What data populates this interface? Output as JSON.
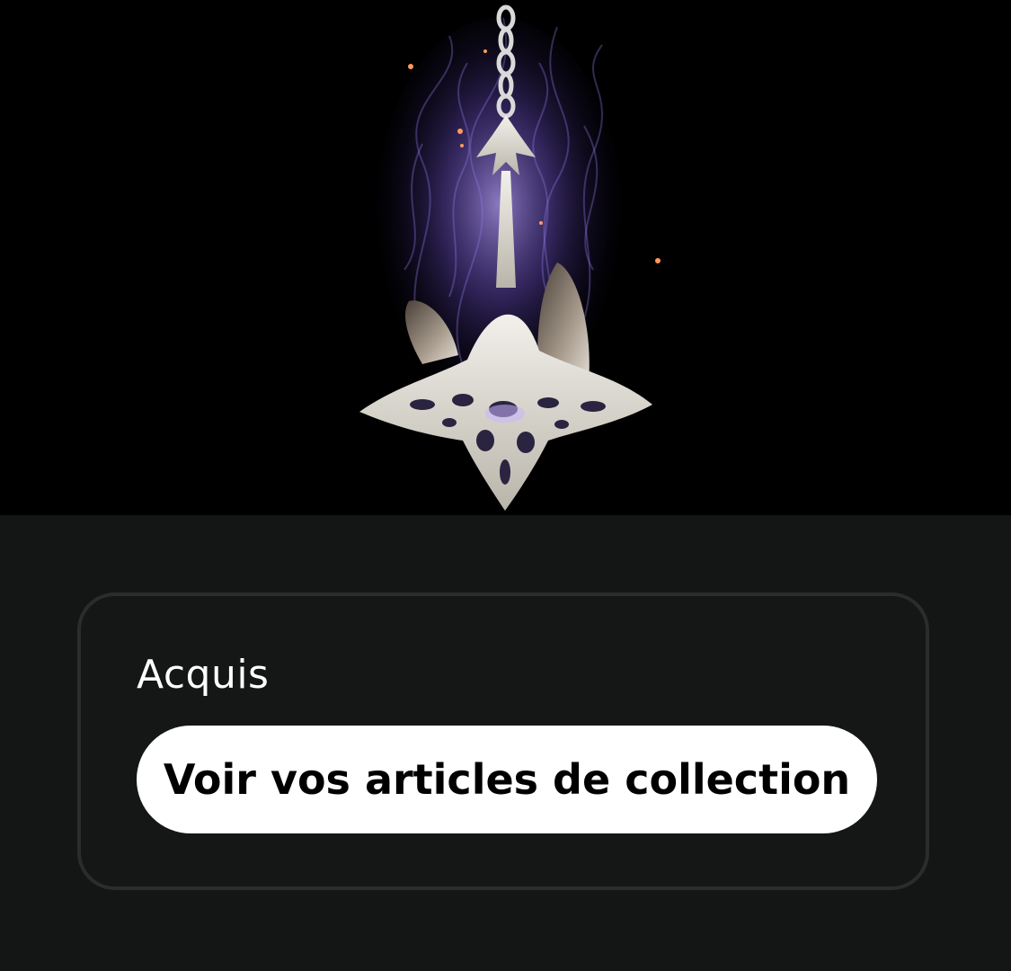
{
  "hero": {
    "image_name": "collectible-artwork"
  },
  "acquired_card": {
    "status": "Acquis",
    "button_label": "Voir vos articles de collection"
  },
  "colors": {
    "page_background": "#141515",
    "hero_background": "#000000",
    "card_border": "#2b2c2c",
    "button_background": "#ffffff",
    "button_text": "#000000",
    "status_text": "#ffffff",
    "glow": "#8a6cd8",
    "sparks": "#ff9a5c"
  }
}
